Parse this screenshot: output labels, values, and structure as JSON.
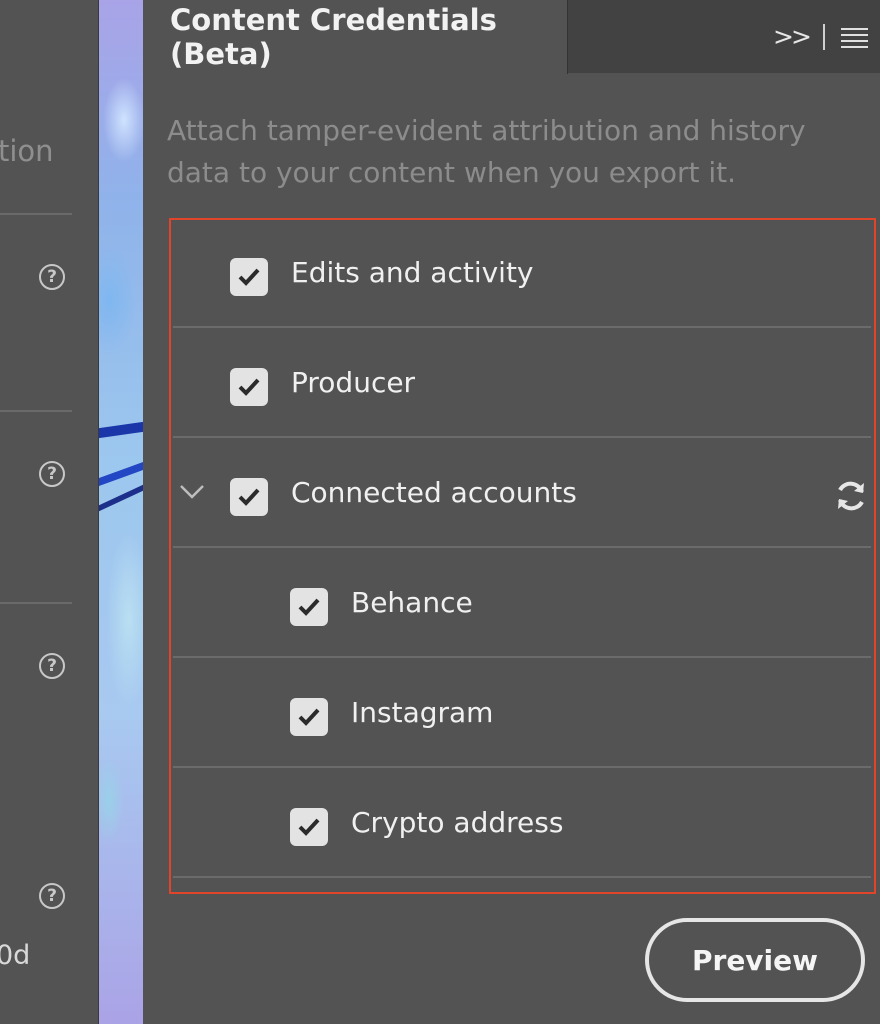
{
  "left_panel": {
    "fragment_text": "tion",
    "bottom_fragment": "0d",
    "help_icon_glyph": "?"
  },
  "panel": {
    "tab_title": "Content Credentials (Beta)",
    "collapse_glyph": ">>",
    "description": "Attach tamper-evident attribution and history data to your content when you export it.",
    "options": [
      {
        "label": "Edits and activity",
        "checked": true,
        "indent": 0
      },
      {
        "label": "Producer",
        "checked": true,
        "indent": 0
      },
      {
        "label": "Connected accounts",
        "checked": true,
        "indent": 0,
        "expanded": true
      },
      {
        "label": "Behance",
        "checked": true,
        "indent": 1
      },
      {
        "label": "Instagram",
        "checked": true,
        "indent": 1
      },
      {
        "label": "Crypto address",
        "checked": true,
        "indent": 1
      }
    ],
    "preview_label": "Preview"
  },
  "colors": {
    "panel_bg": "#535353",
    "header_bg": "#424242",
    "highlight_border": "#e0452a",
    "checkbox_fill": "#e3e3e3"
  },
  "icons": [
    "help-icon",
    "collapse-panel-icon",
    "panel-menu-icon",
    "chevron-down-icon",
    "checkmark-icon",
    "sync-icon"
  ]
}
